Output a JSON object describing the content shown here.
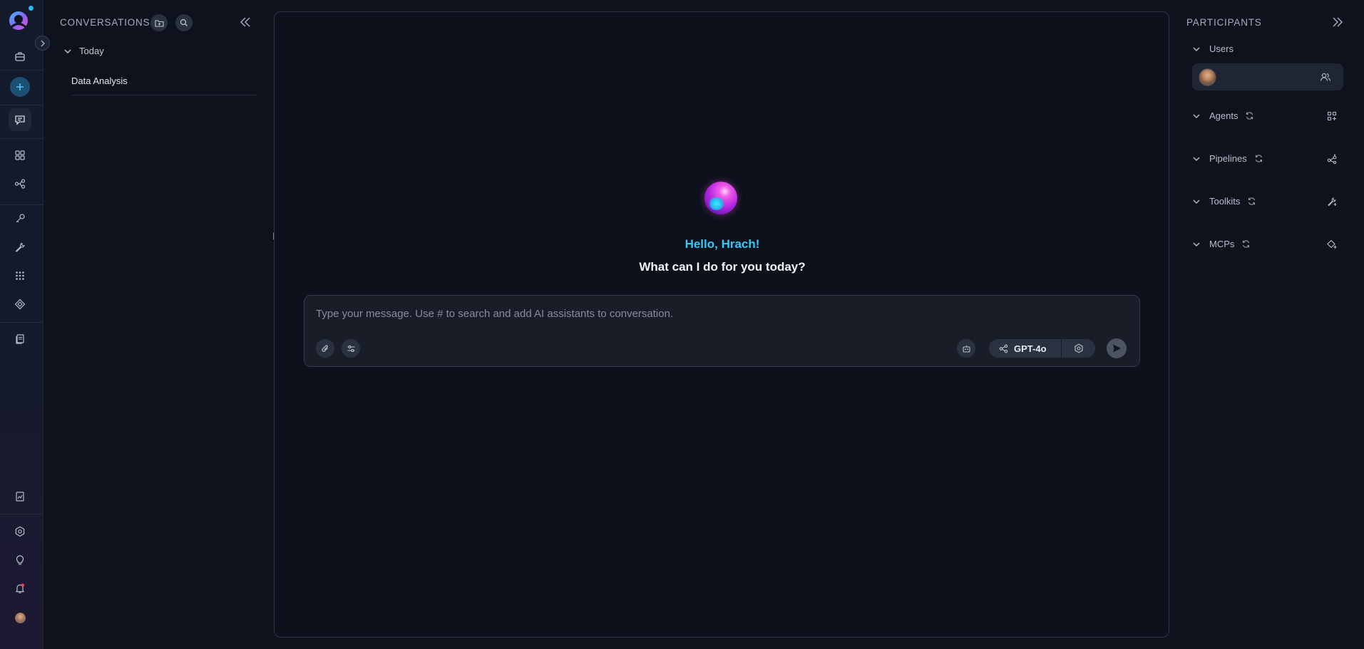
{
  "sidebar_rail": {
    "items": [
      {
        "name": "briefcase-icon"
      },
      {
        "name": "plus-icon"
      },
      {
        "name": "chat-icon",
        "active": true
      },
      {
        "name": "grid-icon"
      },
      {
        "name": "pipelines-icon"
      },
      {
        "name": "key-icon"
      },
      {
        "name": "wrench-icon"
      },
      {
        "name": "apps-icon"
      },
      {
        "name": "toolkit-icon"
      },
      {
        "name": "documents-icon"
      },
      {
        "name": "reports-icon"
      },
      {
        "name": "settings-icon"
      },
      {
        "name": "lightbulb-icon"
      },
      {
        "name": "notifications-icon"
      },
      {
        "name": "avatar"
      }
    ]
  },
  "conversations": {
    "title": "CONVERSATIONS",
    "groups": [
      {
        "label": "Today",
        "items": [
          {
            "label": "Data Analysis"
          }
        ]
      }
    ]
  },
  "chat": {
    "greeting": "Hello, Hrach!",
    "question": "What can I do for you today?",
    "input_placeholder": "Type your message. Use # to search and add AI assistants to conversation.",
    "input_value": "",
    "model": "GPT-4o"
  },
  "participants": {
    "title": "PARTICIPANTS",
    "sections": {
      "users": "Users",
      "agents": "Agents",
      "pipelines": "Pipelines",
      "toolkits": "Toolkits",
      "mcps": "MCPs"
    }
  },
  "colors": {
    "background": "#0e121c",
    "accent": "#33c8f5",
    "orb_primary": "#d040e0",
    "orb_secondary": "#3fe9ff"
  }
}
